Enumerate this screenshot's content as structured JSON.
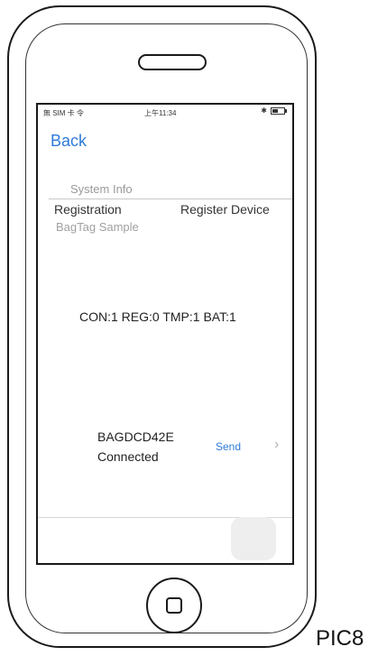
{
  "status_bar": {
    "carrier": "無 SIM 卡 令",
    "time": "上午11:34",
    "bluetooth": "✱"
  },
  "nav": {
    "back_label": "Back"
  },
  "menu": {
    "system_info": "System Info",
    "registration": "Registration",
    "register_device": "Register Device",
    "bagtag_sample": "BagTag Sample"
  },
  "device_status": {
    "line": "CON:1 REG:0 TMP:1 BAT:1"
  },
  "device": {
    "name": "BAGDCD42E",
    "state": "Connected",
    "send_label": "Send",
    "chevron": "›"
  },
  "caption": "PIC8"
}
